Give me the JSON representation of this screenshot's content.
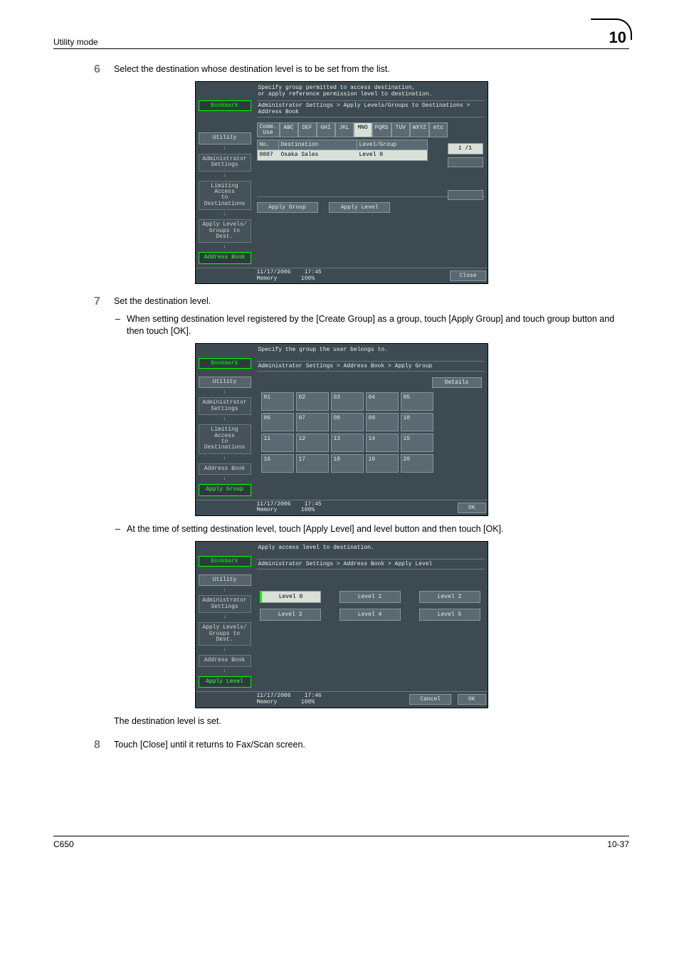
{
  "header": {
    "title": "Utility mode",
    "chapter": "10"
  },
  "steps": {
    "s6": {
      "num": "6",
      "text": "Select the destination whose destination level is to be set from the list."
    },
    "s7": {
      "num": "7",
      "text": "Set the destination level.",
      "sub1": "When setting destination level registered by the [Create Group] as a group, touch [Apply Group] and touch group button and then touch [OK].",
      "sub2": "At the time of setting destination level, touch [Apply Level] and level button and then touch [OK].",
      "tail": "The destination level is set."
    },
    "s8": {
      "num": "8",
      "text": "Touch [Close] until it returns to Fax/Scan screen."
    }
  },
  "lcd1": {
    "msg1": "Specify group permitted to access destination,",
    "msg2": "or apply reference permission level to destination.",
    "bookmark": "Bookmark",
    "crumb": "Administrator Settings > Apply Levels/Groups to Destinations > Address Book",
    "tabs": [
      "Comm.\nUse",
      "ABC",
      "DEF",
      "GHI",
      "JKL",
      "MNO",
      "PQRS",
      "TUV",
      "WXYZ",
      "etc"
    ],
    "tab_sel": "MNO",
    "side": [
      "Utility",
      "Administrator\nSettings",
      "Limiting Access\nto Destinations",
      "Apply Levels/\nGroups to Dest."
    ],
    "side_active": "Address Book",
    "thead": {
      "no": "No.",
      "dest": "Destination",
      "lvl": "Level/Group"
    },
    "row": {
      "no": "0007",
      "dest": "Osaka Sales",
      "lvl": "Level 0"
    },
    "page": "1  /1",
    "apply_group": "Apply Group",
    "apply_level": "Apply Level",
    "status_date": "11/17/2006",
    "status_time": "17:45",
    "status_mem": "Memory",
    "status_pct": "100%",
    "close": "Close"
  },
  "lcd2": {
    "msg": "Specify the group the user belongs to.",
    "bookmark": "Bookmark",
    "crumb": "Administrator Settings > Address Book > Apply Group",
    "details": "Details",
    "side": [
      "Utility",
      "Administrator\nSettings",
      "Limiting Access\nto Destinations",
      "Address Book"
    ],
    "side_active": "Apply Group",
    "grid": [
      "01",
      "02",
      "03",
      "04",
      "05",
      "06",
      "07",
      "08",
      "09",
      "10",
      "11",
      "12",
      "13",
      "14",
      "15",
      "16",
      "17",
      "18",
      "19",
      "20"
    ],
    "status_date": "11/17/2006",
    "status_time": "17:45",
    "status_mem": "Memory",
    "status_pct": "100%",
    "ok": "OK"
  },
  "lcd3": {
    "msg": "Apply access level to destination.",
    "bookmark": "Bookmark",
    "crumb": "Administrator Settings > Address Book > Apply Level",
    "side": [
      "Utility",
      "Administrator\nSettings",
      "Apply Levels/\nGroups to Dest.",
      "Address Book"
    ],
    "side_active": "Apply Level",
    "levels_row1": [
      "Level 0",
      "Level 1",
      "Level 2"
    ],
    "levels_row2": [
      "Level 3",
      "Level 4",
      "Level 5"
    ],
    "sel": "Level 0",
    "status_date": "11/17/2006",
    "status_time": "17:46",
    "status_mem": "Memory",
    "status_pct": "100%",
    "cancel": "Cancel",
    "ok": "OK"
  },
  "footer": {
    "left": "C650",
    "right": "10-37"
  }
}
